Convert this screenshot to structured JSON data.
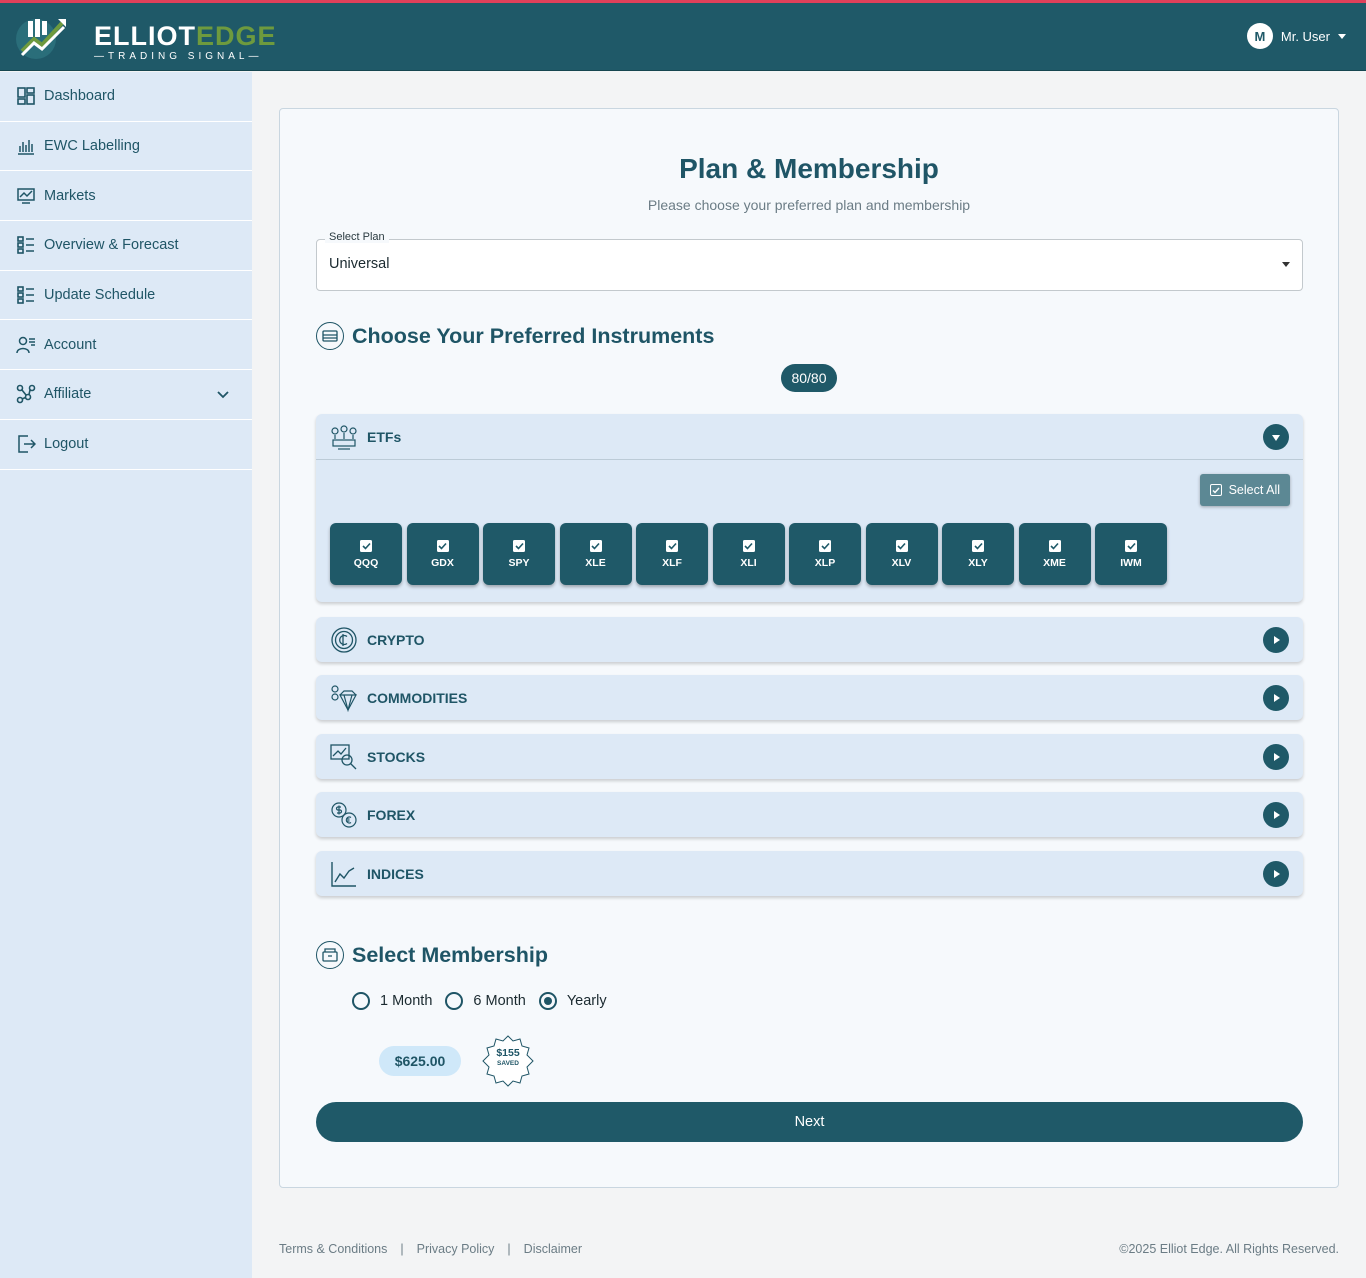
{
  "brand": {
    "name_part1": "ELLIOT",
    "name_part2": "EDGE",
    "tagline": "—TRADING SIGNAL—"
  },
  "user": {
    "initial": "M",
    "name": "Mr. User"
  },
  "sidebar": {
    "items": [
      {
        "label": "Dashboard",
        "icon": "dashboard-icon"
      },
      {
        "label": "EWC Labelling",
        "icon": "bar-chart-icon"
      },
      {
        "label": "Markets",
        "icon": "market-monitor-icon"
      },
      {
        "label": "Overview & Forecast",
        "icon": "list-grid-icon"
      },
      {
        "label": "Update Schedule",
        "icon": "list-grid-icon"
      },
      {
        "label": "Account",
        "icon": "user-list-icon"
      },
      {
        "label": "Affiliate",
        "icon": "network-icon"
      },
      {
        "label": "Logout",
        "icon": "logout-icon"
      }
    ]
  },
  "page": {
    "title": "Plan & Membership",
    "subtitle": "Please choose your preferred plan and membership"
  },
  "plan_select": {
    "label": "Select Plan",
    "value": "Universal"
  },
  "instruments": {
    "heading": "Choose Your Preferred Instruments",
    "count": "80/80",
    "select_all_label": "Select All",
    "categories": [
      {
        "label": "ETFs",
        "expanded": true
      },
      {
        "label": "CRYPTO",
        "expanded": false
      },
      {
        "label": "COMMODITIES",
        "expanded": false
      },
      {
        "label": "STOCKS",
        "expanded": false
      },
      {
        "label": "FOREX",
        "expanded": false
      },
      {
        "label": "INDICES",
        "expanded": false
      }
    ],
    "etfs": [
      "QQQ",
      "GDX",
      "SPY",
      "XLE",
      "XLF",
      "XLI",
      "XLP",
      "XLV",
      "XLY",
      "XME",
      "IWM"
    ]
  },
  "membership": {
    "heading": "Select Membership",
    "options": [
      {
        "label": "1 Month",
        "selected": false
      },
      {
        "label": "6 Month",
        "selected": false
      },
      {
        "label": "Yearly",
        "selected": true
      }
    ],
    "price": "$625.00",
    "saved_amount": "$155",
    "saved_label": "SAVED"
  },
  "next_label": "Next",
  "footer": {
    "links": [
      "Terms & Conditions",
      "Privacy Policy",
      "Disclaimer"
    ],
    "separator": "|",
    "copyright": "©2025 Elliot Edge. All Rights Reserved."
  },
  "colors": {
    "primary": "#1f5968",
    "sidebar_bg": "#dde9f6",
    "accent_top": "#e0405a",
    "brand_green": "#6e9a3e"
  }
}
